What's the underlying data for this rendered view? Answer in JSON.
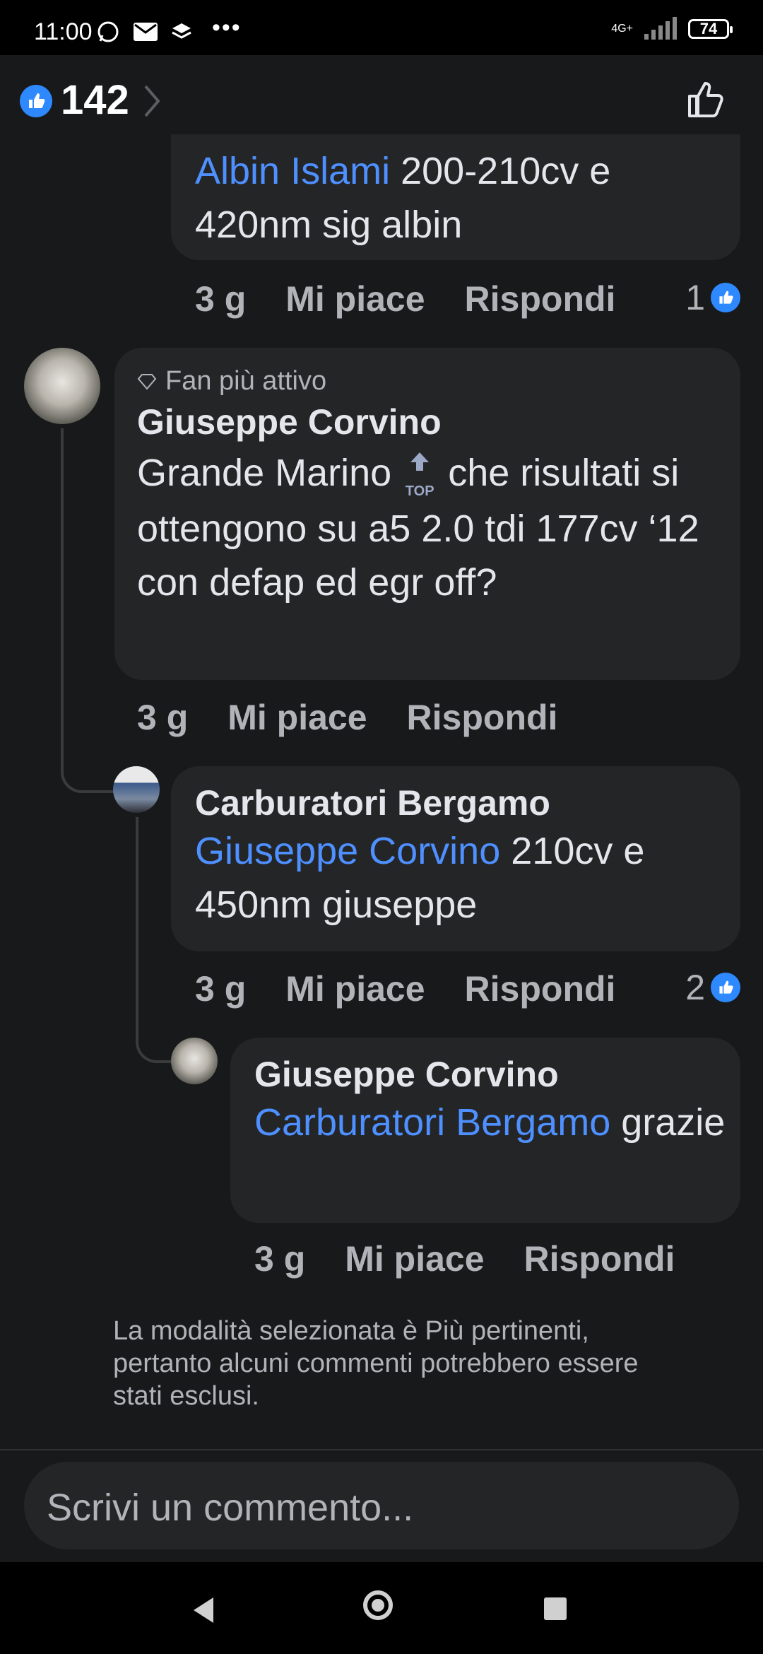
{
  "status_bar": {
    "time": "11:00",
    "network": "4G+",
    "battery": "74"
  },
  "header": {
    "likes_count": "142"
  },
  "comments": [
    {
      "mention": "Albin Islami",
      "text": " 200-210cv e 420nm sig albin",
      "time": "3 g",
      "like": "Mi piace",
      "reply": "Rispondi",
      "reactions": "1"
    },
    {
      "badge": "Fan più attivo",
      "author": "Giuseppe Corvino",
      "text_before": "Grande Marino ",
      "emoji": "⬆️TOP",
      "text_after": "  che risultati si ottengono su a5 2.0 tdi 177cv  ‘12 con defap ed egr off?",
      "time": "3 g",
      "like": "Mi piace",
      "reply": "Rispondi"
    },
    {
      "author": "Carburatori Bergamo",
      "mention": "Giuseppe Corvino",
      "text": " 210cv e 450nm giuseppe",
      "time": "3 g",
      "like": "Mi piace",
      "reply": "Rispondi",
      "reactions": "2"
    },
    {
      "author": "Giuseppe Corvino",
      "mention": "Carburatori Bergamo",
      "text": " grazie",
      "time": "3 g",
      "like": "Mi piace",
      "reply": "Rispondi"
    }
  ],
  "note": "La modalità selezionata è Più pertinenti, pertanto alcuni commenti potrebbero essere stati esclusi.",
  "composer": {
    "placeholder": "Scrivi un commento..."
  },
  "colors": {
    "background": "#18191a",
    "bubble": "#242526",
    "mention": "#4e90ff",
    "like_blue": "#2e89ff"
  }
}
